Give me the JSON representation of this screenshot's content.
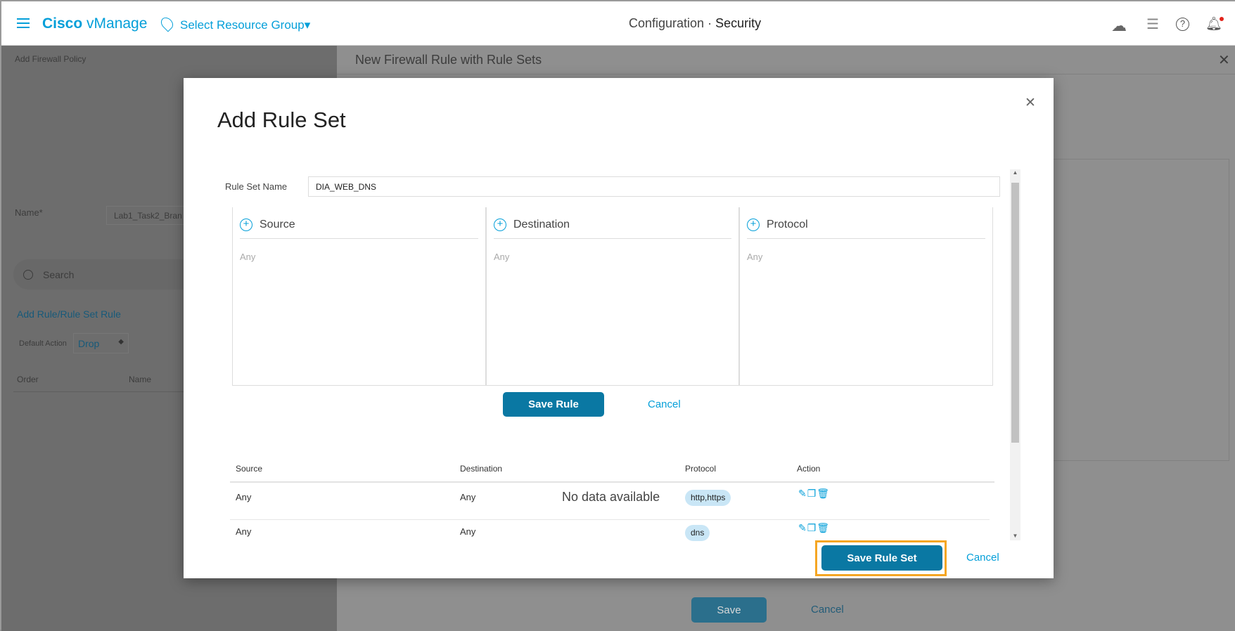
{
  "header": {
    "app_name_bold": "Cisco",
    "app_name": "vManage",
    "resource_group": "Select Resource Group",
    "title_prefix": "Configuration",
    "title_separator": "·",
    "title": "Security",
    "icons": [
      "menu-icon",
      "location-pin-icon",
      "cloud-icon",
      "list-icon",
      "help-icon",
      "bell-icon"
    ]
  },
  "background": {
    "left": {
      "title": "Add Firewall Policy",
      "name_label": "Name*",
      "name_value": "Lab1_Task2_Bran",
      "search_placeholder": "Search",
      "add_rule": "Add Rule/Rule Set Rule",
      "default_action_label": "Default Action",
      "default_action_value": "Drop",
      "columns": [
        "Order",
        "Name"
      ]
    },
    "right": {
      "title": "New Firewall Rule with Rule Sets",
      "save": "Save",
      "cancel": "Cancel"
    }
  },
  "modal": {
    "title": "Add Rule Set",
    "rule_set_name_label": "Rule Set Name",
    "rule_set_name_value": "DIA_WEB_DNS",
    "columns": [
      {
        "label": "Source",
        "value": "Any"
      },
      {
        "label": "Destination",
        "value": "Any"
      },
      {
        "label": "Protocol",
        "value": "Any"
      }
    ],
    "save_rule": "Save Rule",
    "cancel": "Cancel",
    "table": {
      "headers": [
        "Source",
        "Destination",
        "Protocol",
        "Action"
      ],
      "empty_text": "No data available",
      "rows": [
        {
          "source": "Any",
          "destination": "Any",
          "protocol": "http,https"
        },
        {
          "source": "Any",
          "destination": "Any",
          "protocol": "dns"
        }
      ]
    },
    "save_rule_set": "Save Rule Set",
    "cancel_rule_set": "Cancel"
  },
  "colors": {
    "brand": "#049fd9",
    "button": "#0a78a3",
    "highlight": "#f5a623"
  }
}
